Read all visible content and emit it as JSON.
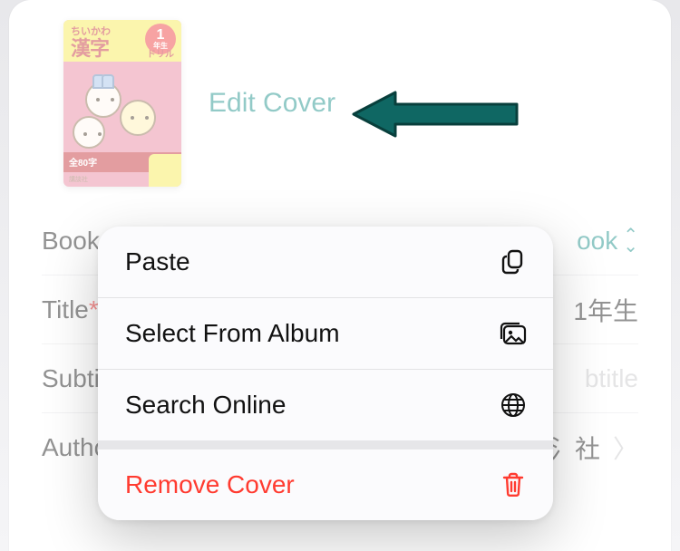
{
  "cover": {
    "edit_label": "Edit Cover",
    "thumb": {
      "top_small": "ちいかわ",
      "kanji": "漢字",
      "drill": "ドリル",
      "grade_num": "1",
      "grade_suffix": "年生",
      "strip": "全80字",
      "publisher": "講談社"
    }
  },
  "form": {
    "book_type": {
      "label": "Book",
      "value": "ook"
    },
    "title": {
      "label": "Title",
      "required_mark": "*",
      "value": "1年生"
    },
    "subtitle": {
      "label": "Subti",
      "placeholder": "btitle"
    },
    "author": {
      "label": "Autho",
      "value": "社"
    }
  },
  "author_suffix_glyph": "〉",
  "menu": {
    "paste": "Paste",
    "album": "Select From Album",
    "search": "Search Online",
    "remove": "Remove Cover"
  },
  "colors": {
    "teal": "#0f8a84",
    "destructive": "#ff3b30"
  }
}
